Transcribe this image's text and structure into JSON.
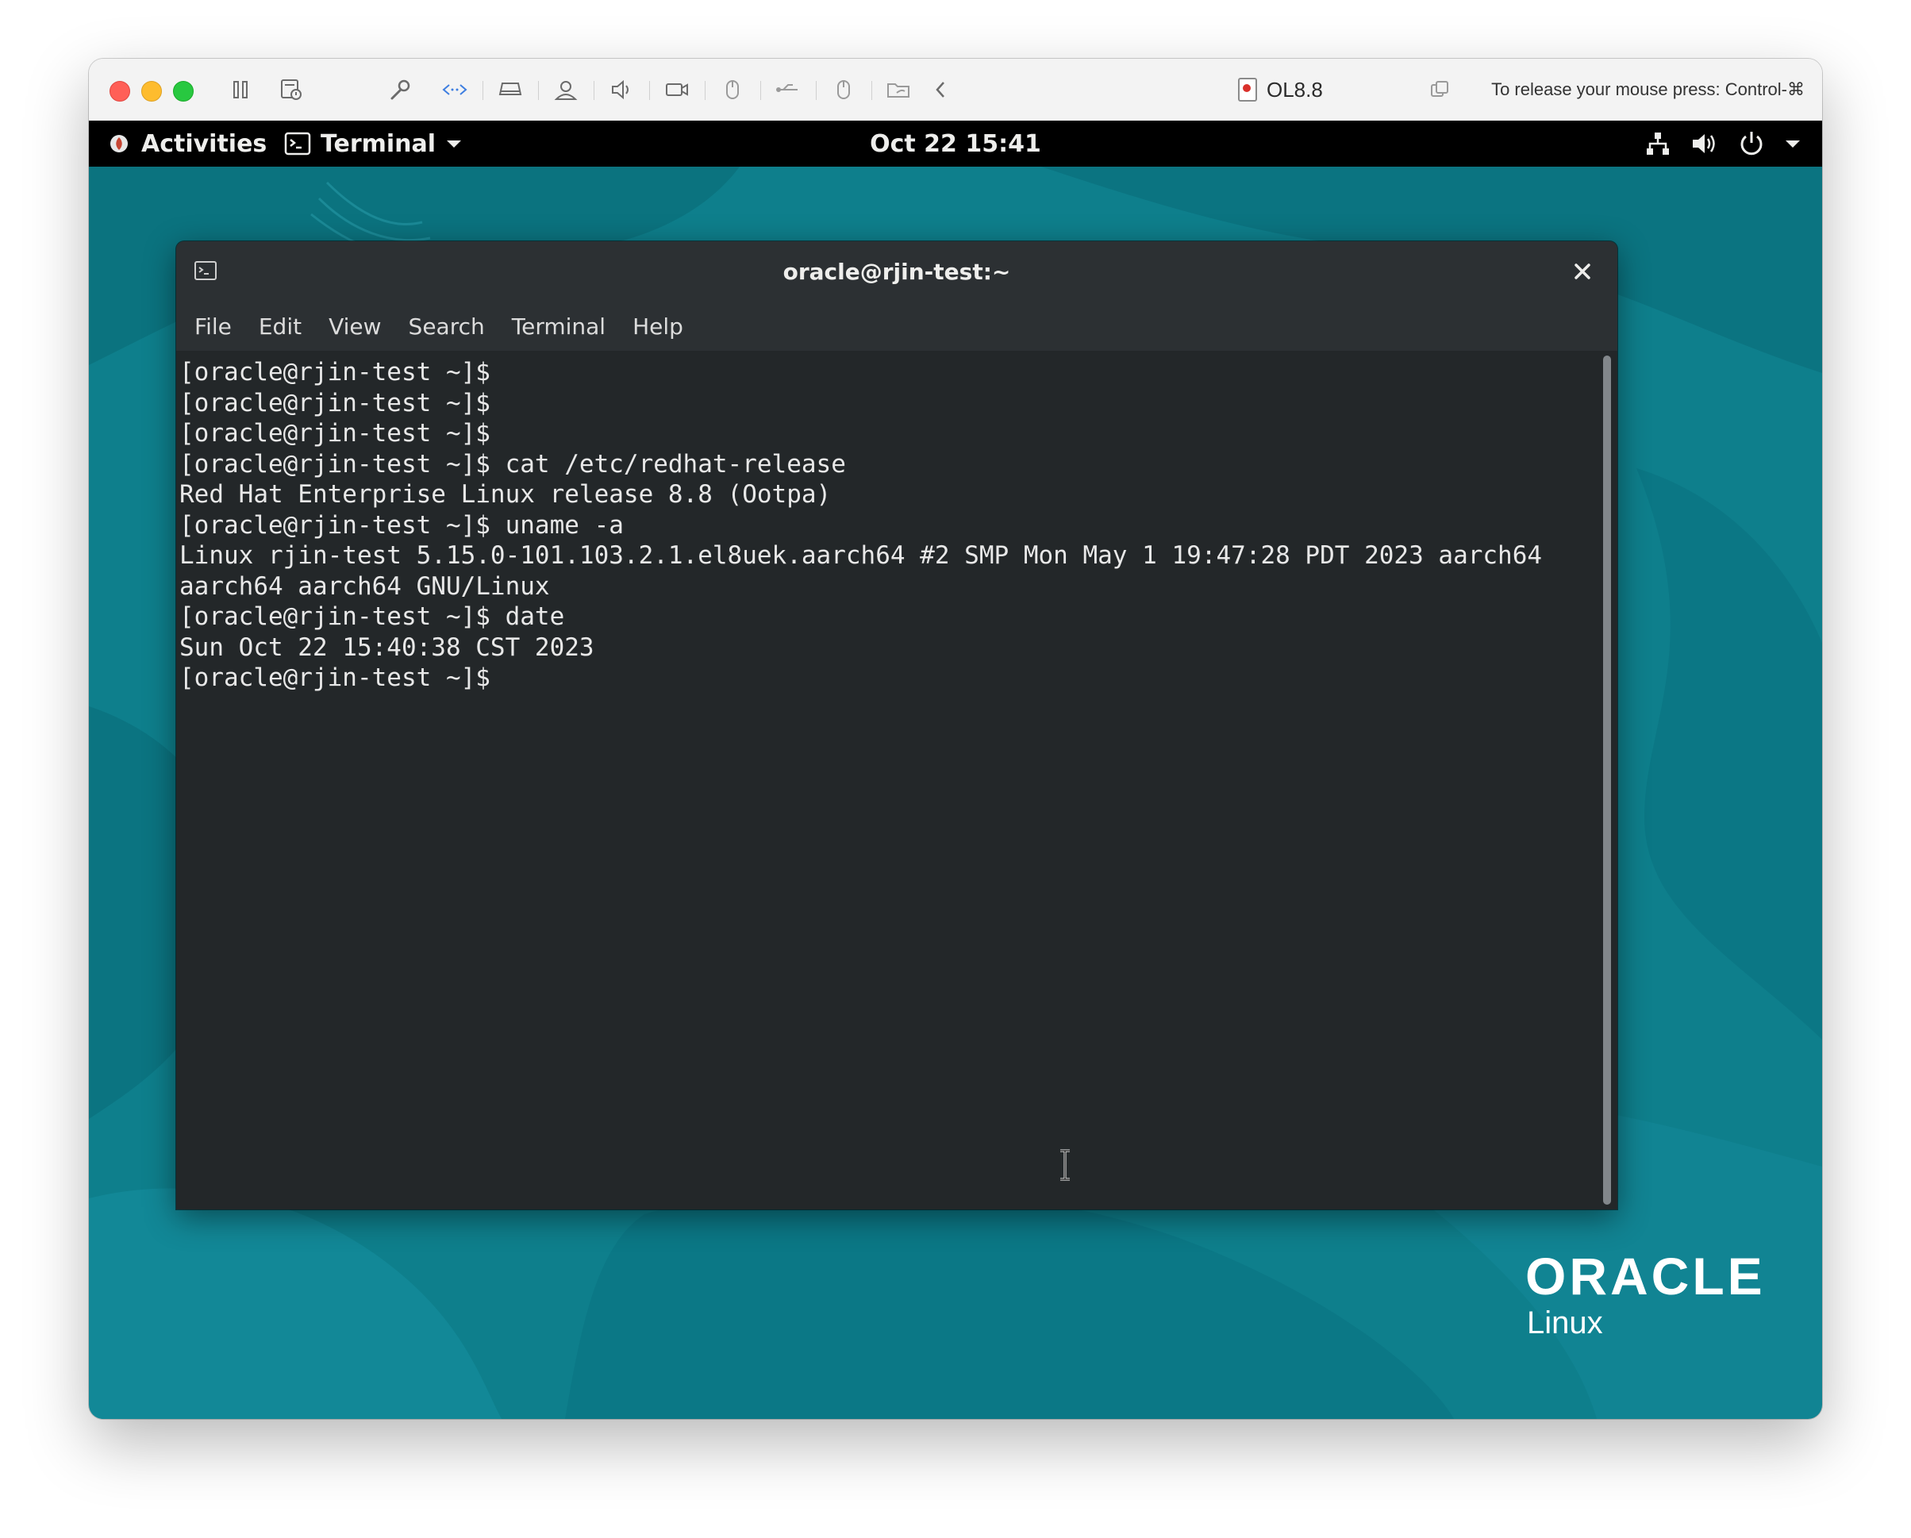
{
  "vm_window": {
    "title": "OL8.8",
    "release_hint": "To release your mouse press: Control-⌘",
    "toolbar_icons": [
      "pause-icon",
      "snapshot-icon",
      "settings-wrench-icon",
      "network-arrows-icon",
      "disk-drive-icon",
      "user-icon",
      "volume-icon",
      "camera-icon",
      "mouse-icon",
      "usb-icon",
      "mouse-icon",
      "shared-folder-icon",
      "chevron-left-icon"
    ]
  },
  "gnome_topbar": {
    "activities_label": "Activities",
    "app_menu_label": "Terminal",
    "clock": "Oct 22  15:41",
    "status_icons": [
      "network-icon",
      "volume-icon",
      "power-icon",
      "chevron-down-icon"
    ]
  },
  "terminal": {
    "title": "oracle@rjin-test:~",
    "menu": [
      "File",
      "Edit",
      "View",
      "Search",
      "Terminal",
      "Help"
    ],
    "lines": [
      "[oracle@rjin-test ~]$",
      "[oracle@rjin-test ~]$",
      "[oracle@rjin-test ~]$",
      "[oracle@rjin-test ~]$ cat /etc/redhat-release",
      "Red Hat Enterprise Linux release 8.8 (Ootpa)",
      "[oracle@rjin-test ~]$ uname -a",
      "Linux rjin-test 5.15.0-101.103.2.1.el8uek.aarch64 #2 SMP Mon May 1 19:47:28 PDT 2023 aarch64",
      "aarch64 aarch64 GNU/Linux",
      "[oracle@rjin-test ~]$ date",
      "Sun Oct 22 15:40:38 CST 2023",
      "[oracle@rjin-test ~]$"
    ]
  },
  "desktop": {
    "brand_word": "ORACLE",
    "brand_sub": "Linux",
    "background_color": "#0e7f8c"
  }
}
